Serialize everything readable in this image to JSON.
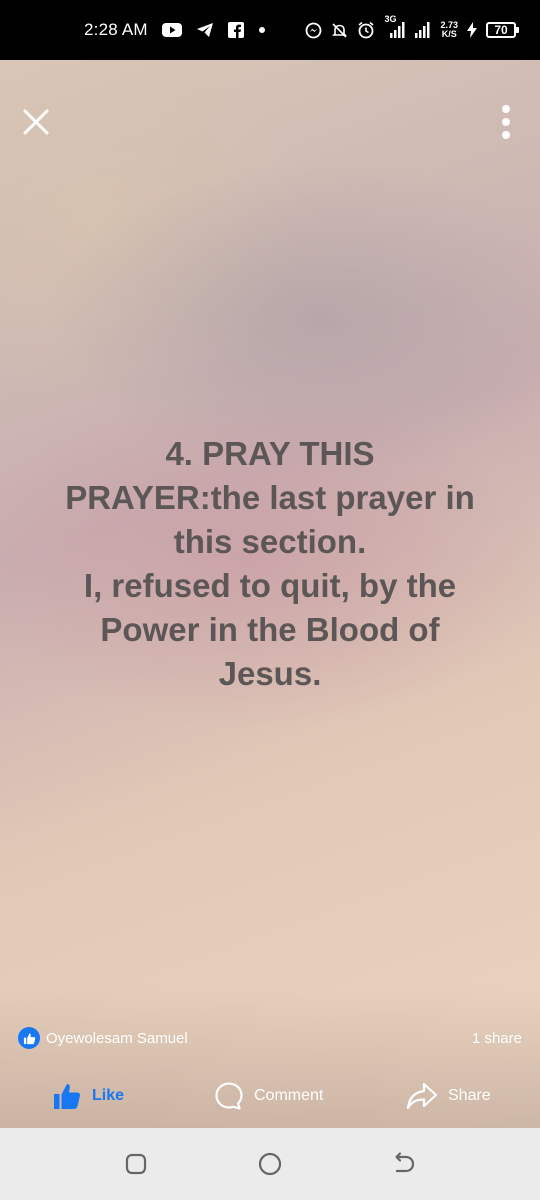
{
  "status_bar": {
    "time": "2:28 AM",
    "network_type": "3G",
    "net_speed_value": "2.73",
    "net_speed_unit": "K/S",
    "battery_level": "70",
    "icons": [
      "youtube-icon",
      "telegram-icon",
      "facebook-icon",
      "dot-icon",
      "messenger-icon",
      "mute-icon",
      "alarm-icon",
      "signal-icon",
      "signal-icon",
      "charging-icon",
      "battery-icon"
    ]
  },
  "story": {
    "text_lines": [
      "4. PRAY THIS",
      "PRAYER:the last prayer in",
      "this section.",
      "I, refused to quit, by the",
      "Power in the Blood of",
      "Jesus."
    ],
    "text_color": "#5c5656"
  },
  "reactions": {
    "reactor_name": "Oyewolesam Samuel",
    "share_count": "1 share"
  },
  "actions": {
    "like": "Like",
    "comment": "Comment",
    "share": "Share"
  },
  "colors": {
    "accent": "#1877f2",
    "nav_bar": "#ebebeb"
  }
}
